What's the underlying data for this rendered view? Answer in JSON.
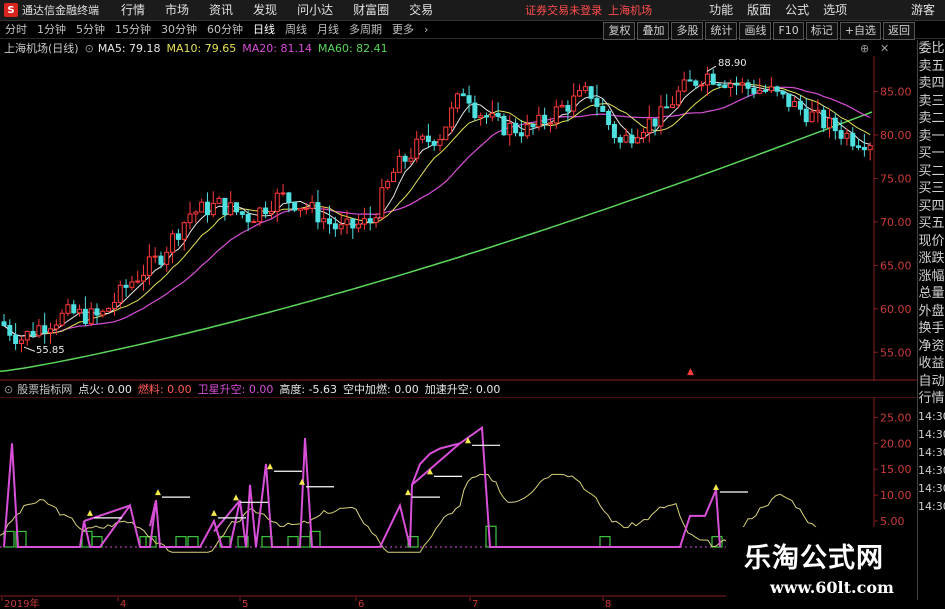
{
  "titlebar": {
    "app_title": "通达信金融终端",
    "menus": [
      "行情",
      "市场",
      "资讯",
      "发现",
      "问小达",
      "财富圈",
      "交易"
    ],
    "login_warning": "证券交易未登录",
    "stock_title": "上海机场",
    "right_menus": [
      "功能",
      "版面",
      "公式",
      "选项"
    ],
    "guest": "游客"
  },
  "toolbar": {
    "periods": [
      "分时",
      "1分钟",
      "5分钟",
      "15分钟",
      "30分钟",
      "60分钟",
      "日线",
      "周线",
      "月线",
      "多周期",
      "更多"
    ],
    "active_period": "日线",
    "buttons": [
      "复权",
      "叠加",
      "多股",
      "统计",
      "画线",
      "F10",
      "标记",
      "+自选",
      "返回"
    ]
  },
  "main_chart": {
    "stock_name": "上海机场(日线)",
    "ma5": "MA5: 79.18",
    "ma10": "MA10: 79.65",
    "ma20": "MA20: 81.14",
    "ma60": "MA60: 82.41",
    "high_label": "88.90",
    "low_label": "55.85",
    "y_ticks": [
      "85.00",
      "80.00",
      "75.00",
      "70.00",
      "65.00",
      "60.00",
      "55.00"
    ],
    "colors": {
      "ma5": "#e6e6e6",
      "ma10": "#e3e05a",
      "ma20": "#d84fd8",
      "ma60": "#5ad65a",
      "up": "#ff3b3b",
      "down": "#4fe0e0"
    }
  },
  "indicator": {
    "name": "股票指标网",
    "fields": [
      {
        "label": "点火: 0.00",
        "color": "#e8e8e8"
      },
      {
        "label": "燃料: 0.00",
        "color": "#ff5a5a"
      },
      {
        "label": "卫星升空: 0.00",
        "color": "#d84fd8"
      },
      {
        "label": "高度: -5.63",
        "color": "#e8e8e8"
      },
      {
        "label": "空中加燃: 0.00",
        "color": "#e8e8e8"
      },
      {
        "label": "加速升空: 0.00",
        "color": "#e8e8e8"
      }
    ],
    "y_ticks": [
      "25.00",
      "20.00",
      "15.00",
      "10.00",
      "5.00"
    ]
  },
  "x_axis": [
    "2019年",
    "4",
    "5",
    "6",
    "7",
    "8"
  ],
  "right_panel": [
    "委比",
    "卖五",
    "卖四",
    "卖三",
    "卖二",
    "卖一",
    "买一",
    "买二",
    "买三",
    "买四",
    "买五",
    "现价",
    "涨跌",
    "涨幅",
    "总量",
    "外盘",
    "换手",
    "净资",
    "收益",
    "自动",
    "行情",
    "14:30",
    "14:30",
    "14:30",
    "14:30",
    "14:30",
    "14:30"
  ],
  "watermark": {
    "title": "乐淘公式网",
    "url": "www.60lt.com"
  }
}
